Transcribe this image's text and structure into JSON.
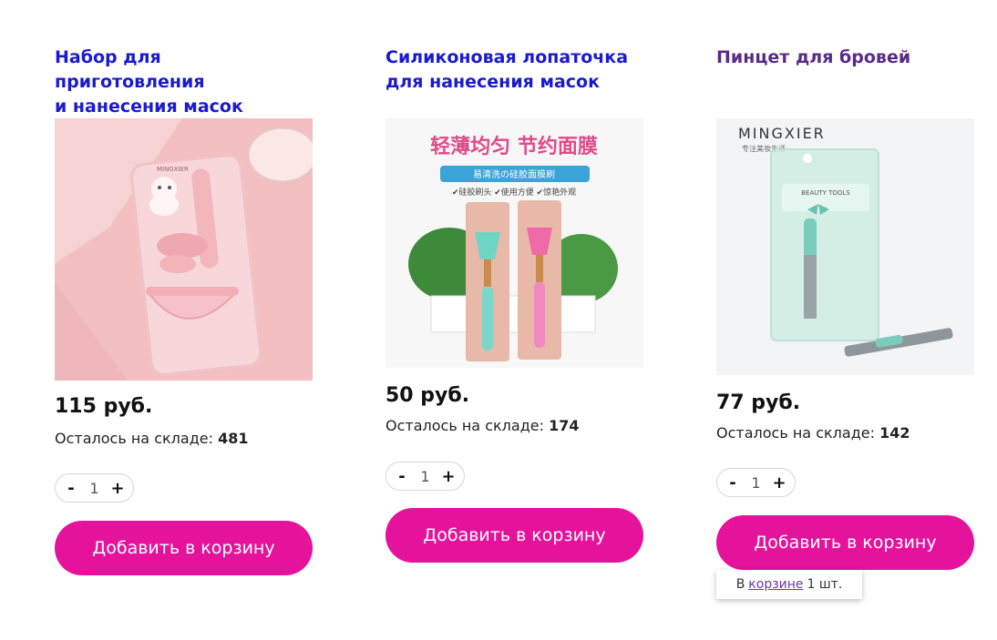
{
  "products": [
    {
      "title_line1": "Набор для приготовления",
      "title_line2": "и нанесения масок",
      "price": "115 руб.",
      "stock_label": "Осталось на складе:",
      "stock_count": "481",
      "qty": "1",
      "minus": "-",
      "plus": "+",
      "add_label": "Добавить в корзину",
      "image_text": "MINGXIER"
    },
    {
      "title_line1": "Силиконовая лопаточка",
      "title_line2": "для нанесения масок",
      "price": "50 руб.",
      "stock_label": "Осталось на складе:",
      "stock_count": "174",
      "qty": "1",
      "minus": "-",
      "plus": "+",
      "add_label": "Добавить в корзину",
      "image_text_top": "轻薄均匀 节约面膜",
      "image_text_banner": "易清洗の硅胶面膜刷",
      "image_text_features": "✔硅胶刷头 ✔使用方便 ✔惊艳外观"
    },
    {
      "title_line1": "Пинцет для бровей",
      "title_line2": "",
      "price": "77 руб.",
      "stock_label": "Осталось на складе:",
      "stock_count": "142",
      "qty": "1",
      "minus": "-",
      "plus": "+",
      "add_label": "Добавить в корзину",
      "image_brand": "MINGXIER",
      "image_subtext": "专注美妆生活",
      "image_pack_label": "BEAUTY TOOLS"
    }
  ],
  "cart_note": {
    "prefix": "В",
    "link": "корзине",
    "suffix": "1 шт."
  },
  "colors": {
    "accent": "#e5129b",
    "link": "#1a1ad0",
    "visited": "#5a2a8a"
  }
}
